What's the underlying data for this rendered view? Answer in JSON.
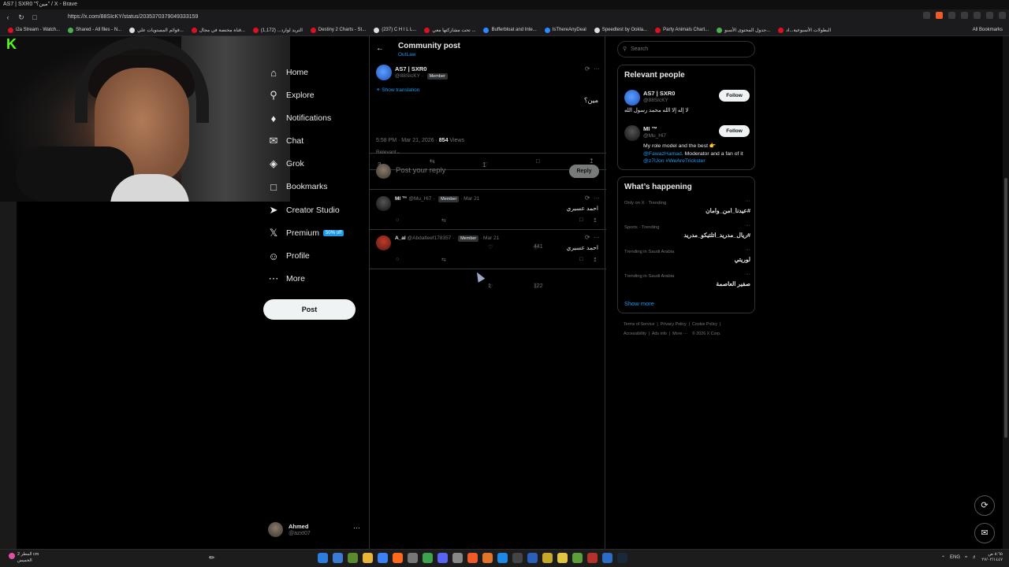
{
  "browser": {
    "window_title": "AS7 | SXR0 \"مين؟\" / X - Brave",
    "url": "https://x.com/88SIcKY/status/2035370379049333159",
    "bookmarks": [
      "i2a Stream - Watch...",
      "Shared - All files - N...",
      "قوائم المستويات علي...",
      "قناة مختصة في مجال...",
      "التريد لوارد... (1,172)",
      "Destiny 2 Charts - St...",
      "(237) C H I L L...",
      "تحت مشاركتها معي ...",
      "Bufferbloat and Inte...",
      "IsThereAnyDeal",
      "Speedtest by Ookla...",
      "Party Animals Chart...",
      "جدول المحتوى الأسبو...",
      "البطولات الأسبوعية...اد"
    ],
    "all_bookmarks": "All Bookmarks"
  },
  "nav": {
    "items": [
      {
        "label": "Home",
        "icon": "home-icon"
      },
      {
        "label": "Explore",
        "icon": "search-icon"
      },
      {
        "label": "Notifications",
        "icon": "bell-icon"
      },
      {
        "label": "Chat",
        "icon": "chat-icon"
      },
      {
        "label": "Grok",
        "icon": "grok-icon"
      },
      {
        "label": "Bookmarks",
        "icon": "bookmark-icon"
      },
      {
        "label": "Creator Studio",
        "icon": "rocket-icon"
      },
      {
        "label": "Premium",
        "icon": "x-logo-icon"
      },
      {
        "label": "Profile",
        "icon": "person-icon"
      },
      {
        "label": "More",
        "icon": "more-circle-icon"
      }
    ],
    "premium_badge": "50% off",
    "post_button": "Post",
    "account": {
      "name": "Ahmed",
      "handle": "@azxt07"
    }
  },
  "header": {
    "title": "Community post",
    "community": "OutLaw"
  },
  "post": {
    "author": "AS7 | SXR0",
    "handle": "@88SIcKY",
    "member_badge": "Member",
    "show_translation": "Show translation",
    "text": "مين؟",
    "time": "5:58 PM · Mar 21, 2026 ·",
    "views": "854",
    "views_label": "Views",
    "replies": "2",
    "likes": "1"
  },
  "sort": "Relevant",
  "reply_box": {
    "placeholder": "Post your reply",
    "button": "Reply"
  },
  "replies": [
    {
      "name": "MI ™",
      "handle": "@Mu_Hi7",
      "badge": "Member",
      "date": "· Mar 21",
      "text": "احمد عسيري",
      "likes": "",
      "views": "441"
    },
    {
      "name": "A_al",
      "handle": "@Abdalteef178357",
      "badge": "Member",
      "date": "· Mar 21",
      "text": "احمد عسيري",
      "likes": "1",
      "views": "122"
    }
  ],
  "search": {
    "placeholder": "Search"
  },
  "relevant_people": {
    "title": "Relevant people",
    "people": [
      {
        "name": "AS7 | SXR0",
        "handle": "@88SIcKY",
        "follow": "Follow",
        "bio": "لا إله إلا الله محمد رسول الله"
      },
      {
        "name": "MI ™",
        "handle": "@Mu_Hi7",
        "follow": "Follow",
        "bio_pre": "My role model and the best 👉",
        "bio_link1": "@FawazHamad",
        "bio_mid": ". Moderator and a fan of it",
        "bio_link2": "@z7lJon #WeAreTrickster"
      }
    ]
  },
  "happening": {
    "title": "What’s happening",
    "trends": [
      {
        "context": "Only on X · Trending",
        "topic": "#عيدنا_امن_وامان"
      },
      {
        "context": "Sports · Trending",
        "topic": "#ريال_مدريد_اتلتيكو_مدريد"
      },
      {
        "context": "Trending in Saudi Arabia",
        "topic": "لوريتي"
      },
      {
        "context": "Trending in Saudi Arabia",
        "topic": "صفير العاصمة"
      }
    ],
    "show_more": "Show more"
  },
  "footer": {
    "links": [
      "Terms of Service",
      "Privacy Policy",
      "Cookie Policy",
      "Accessibility",
      "Ads info",
      "More ···",
      "© 2026 X Corp."
    ]
  },
  "taskbar": {
    "weather_line1": "المطر 2 cm",
    "weather_line2": "الخميس",
    "lang": "ENG",
    "clock_line1": "٨:٦٥ ص",
    "clock_line2": "٢٧/٠٢/١٤٤٧"
  }
}
